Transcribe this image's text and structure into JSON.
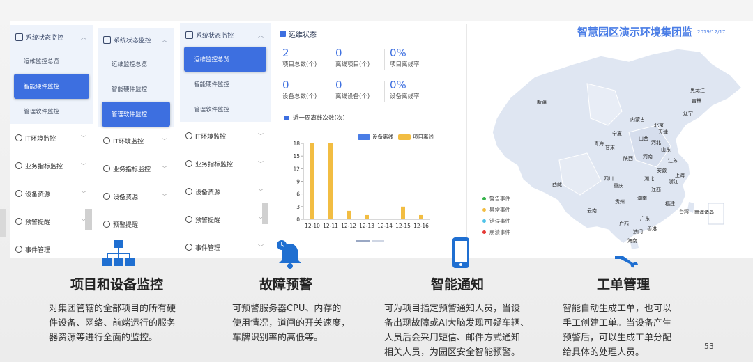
{
  "sidebar1": {
    "group": "系统状态监控",
    "subs": [
      "运维监控总览",
      "智能硬件监控",
      "管理软件监控"
    ],
    "active_index": 1,
    "items": [
      "IT环境监控",
      "业务指标监控",
      "设备资源",
      "预警提醒",
      "事件管理"
    ]
  },
  "sidebar2": {
    "group": "系统状态监控",
    "subs": [
      "运维监控总览",
      "智能硬件监控",
      "管理软件监控"
    ],
    "active_index": 2,
    "items": [
      "IT环境监控",
      "业务指标监控",
      "设备资源",
      "预警提醒"
    ]
  },
  "sidebar3": {
    "group": "系统状态监控",
    "subs": [
      "运维监控总览",
      "智能硬件监控",
      "管理软件监控"
    ],
    "active_index": 0,
    "items": [
      "IT环境监控",
      "业务指标监控",
      "设备资源",
      "预警提醒",
      "事件管理"
    ]
  },
  "ops": {
    "title": "运维状态",
    "stats": [
      {
        "value": "2",
        "label": "项目总数(个)"
      },
      {
        "value": "0",
        "label": "离线项目(个)"
      },
      {
        "value": "0%",
        "label": "项目离线率"
      },
      {
        "value": "0",
        "label": "设备总数(个)"
      },
      {
        "value": "0",
        "label": "离线设备(个)"
      },
      {
        "value": "0%",
        "label": "设备离线率"
      }
    ],
    "chart_title": "近一周离线次数(次)"
  },
  "chart_data": {
    "type": "bar",
    "categories": [
      "12-10",
      "12-11",
      "12-12",
      "12-13",
      "12-14",
      "12-15",
      "12-16"
    ],
    "series": [
      {
        "name": "设备离线",
        "values": [
          0,
          0,
          0,
          0,
          0,
          0,
          0
        ],
        "color": "#4a7de6"
      },
      {
        "name": "项目离线",
        "values": [
          18,
          18,
          2,
          1,
          0,
          3,
          1
        ],
        "color": "#f2bd42"
      }
    ],
    "yticks": [
      0,
      3,
      6,
      9,
      12,
      15,
      18
    ],
    "ylim": [
      0,
      18
    ],
    "legend": "top-right"
  },
  "map": {
    "title": "智慧园区演示环境集团监",
    "date": "2019/12/17",
    "legend": [
      {
        "label": "警告事件",
        "color": "#35b34a"
      },
      {
        "label": "异常事件",
        "color": "#f2bd42"
      },
      {
        "label": "错误事件",
        "color": "#4fc3e8"
      },
      {
        "label": "崩溃事件",
        "color": "#e53935"
      }
    ],
    "cities": [
      "黑龙江",
      "吉林",
      "新疆",
      "辽宁",
      "内蒙古",
      "北京",
      "天津",
      "宁夏",
      "山西",
      "河北",
      "青海",
      "甘肃",
      "山东",
      "陕西",
      "河南",
      "西藏",
      "四川",
      "重庆",
      "湖北",
      "安徽",
      "上海",
      "浙江",
      "江西",
      "贵州",
      "湖南",
      "福建",
      "云南",
      "广西",
      "广东",
      "台湾",
      "南海诸岛",
      "澳门",
      "香港",
      "海南",
      "江苏"
    ]
  },
  "features": [
    {
      "icon": "hierarchy-icon",
      "title": "项目和设备监控",
      "desc": [
        "对集团管辖的全部项目的所有硬",
        "件设备、网络、前端运行的服务",
        "器资源等进行全面的监控。"
      ]
    },
    {
      "icon": "alarm-bell-icon",
      "title": "故障预警",
      "desc": [
        "可预警服务器CPU、内存的",
        "使用情况，道闸的开关速度，",
        "车牌识别率的高低等。"
      ]
    },
    {
      "icon": "mobile-phone-icon",
      "title": "智能通知",
      "desc": [
        "可为项目指定预警通知人员，当设",
        "备出现故障或AI大脑发现可疑车辆、",
        "人员后会采用短信、邮件方式通知",
        "相关人员，为园区安全智能预警。"
      ]
    },
    {
      "icon": "wrench-icon",
      "title": "工单管理",
      "desc": [
        "智能自动生成工单，也可以",
        "手工创建工单。当设备产生",
        "预警后，可以生成工单分配",
        "给具体的处理人员。"
      ]
    }
  ],
  "page_number": "53"
}
